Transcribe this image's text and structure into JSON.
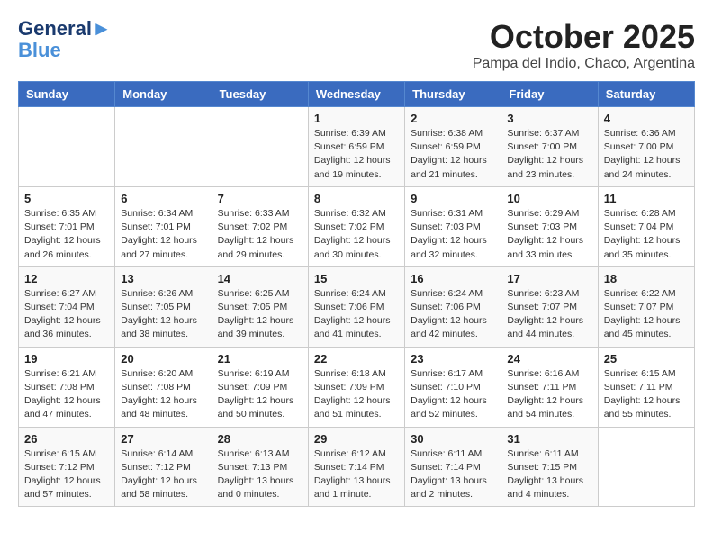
{
  "header": {
    "logo_line1": "General",
    "logo_line2": "Blue",
    "month": "October 2025",
    "location": "Pampa del Indio, Chaco, Argentina"
  },
  "days_of_week": [
    "Sunday",
    "Monday",
    "Tuesday",
    "Wednesday",
    "Thursday",
    "Friday",
    "Saturday"
  ],
  "weeks": [
    [
      {
        "day": "",
        "info": ""
      },
      {
        "day": "",
        "info": ""
      },
      {
        "day": "",
        "info": ""
      },
      {
        "day": "1",
        "info": "Sunrise: 6:39 AM\nSunset: 6:59 PM\nDaylight: 12 hours\nand 19 minutes."
      },
      {
        "day": "2",
        "info": "Sunrise: 6:38 AM\nSunset: 6:59 PM\nDaylight: 12 hours\nand 21 minutes."
      },
      {
        "day": "3",
        "info": "Sunrise: 6:37 AM\nSunset: 7:00 PM\nDaylight: 12 hours\nand 23 minutes."
      },
      {
        "day": "4",
        "info": "Sunrise: 6:36 AM\nSunset: 7:00 PM\nDaylight: 12 hours\nand 24 minutes."
      }
    ],
    [
      {
        "day": "5",
        "info": "Sunrise: 6:35 AM\nSunset: 7:01 PM\nDaylight: 12 hours\nand 26 minutes."
      },
      {
        "day": "6",
        "info": "Sunrise: 6:34 AM\nSunset: 7:01 PM\nDaylight: 12 hours\nand 27 minutes."
      },
      {
        "day": "7",
        "info": "Sunrise: 6:33 AM\nSunset: 7:02 PM\nDaylight: 12 hours\nand 29 minutes."
      },
      {
        "day": "8",
        "info": "Sunrise: 6:32 AM\nSunset: 7:02 PM\nDaylight: 12 hours\nand 30 minutes."
      },
      {
        "day": "9",
        "info": "Sunrise: 6:31 AM\nSunset: 7:03 PM\nDaylight: 12 hours\nand 32 minutes."
      },
      {
        "day": "10",
        "info": "Sunrise: 6:29 AM\nSunset: 7:03 PM\nDaylight: 12 hours\nand 33 minutes."
      },
      {
        "day": "11",
        "info": "Sunrise: 6:28 AM\nSunset: 7:04 PM\nDaylight: 12 hours\nand 35 minutes."
      }
    ],
    [
      {
        "day": "12",
        "info": "Sunrise: 6:27 AM\nSunset: 7:04 PM\nDaylight: 12 hours\nand 36 minutes."
      },
      {
        "day": "13",
        "info": "Sunrise: 6:26 AM\nSunset: 7:05 PM\nDaylight: 12 hours\nand 38 minutes."
      },
      {
        "day": "14",
        "info": "Sunrise: 6:25 AM\nSunset: 7:05 PM\nDaylight: 12 hours\nand 39 minutes."
      },
      {
        "day": "15",
        "info": "Sunrise: 6:24 AM\nSunset: 7:06 PM\nDaylight: 12 hours\nand 41 minutes."
      },
      {
        "day": "16",
        "info": "Sunrise: 6:24 AM\nSunset: 7:06 PM\nDaylight: 12 hours\nand 42 minutes."
      },
      {
        "day": "17",
        "info": "Sunrise: 6:23 AM\nSunset: 7:07 PM\nDaylight: 12 hours\nand 44 minutes."
      },
      {
        "day": "18",
        "info": "Sunrise: 6:22 AM\nSunset: 7:07 PM\nDaylight: 12 hours\nand 45 minutes."
      }
    ],
    [
      {
        "day": "19",
        "info": "Sunrise: 6:21 AM\nSunset: 7:08 PM\nDaylight: 12 hours\nand 47 minutes."
      },
      {
        "day": "20",
        "info": "Sunrise: 6:20 AM\nSunset: 7:08 PM\nDaylight: 12 hours\nand 48 minutes."
      },
      {
        "day": "21",
        "info": "Sunrise: 6:19 AM\nSunset: 7:09 PM\nDaylight: 12 hours\nand 50 minutes."
      },
      {
        "day": "22",
        "info": "Sunrise: 6:18 AM\nSunset: 7:09 PM\nDaylight: 12 hours\nand 51 minutes."
      },
      {
        "day": "23",
        "info": "Sunrise: 6:17 AM\nSunset: 7:10 PM\nDaylight: 12 hours\nand 52 minutes."
      },
      {
        "day": "24",
        "info": "Sunrise: 6:16 AM\nSunset: 7:11 PM\nDaylight: 12 hours\nand 54 minutes."
      },
      {
        "day": "25",
        "info": "Sunrise: 6:15 AM\nSunset: 7:11 PM\nDaylight: 12 hours\nand 55 minutes."
      }
    ],
    [
      {
        "day": "26",
        "info": "Sunrise: 6:15 AM\nSunset: 7:12 PM\nDaylight: 12 hours\nand 57 minutes."
      },
      {
        "day": "27",
        "info": "Sunrise: 6:14 AM\nSunset: 7:12 PM\nDaylight: 12 hours\nand 58 minutes."
      },
      {
        "day": "28",
        "info": "Sunrise: 6:13 AM\nSunset: 7:13 PM\nDaylight: 13 hours\nand 0 minutes."
      },
      {
        "day": "29",
        "info": "Sunrise: 6:12 AM\nSunset: 7:14 PM\nDaylight: 13 hours\nand 1 minute."
      },
      {
        "day": "30",
        "info": "Sunrise: 6:11 AM\nSunset: 7:14 PM\nDaylight: 13 hours\nand 2 minutes."
      },
      {
        "day": "31",
        "info": "Sunrise: 6:11 AM\nSunset: 7:15 PM\nDaylight: 13 hours\nand 4 minutes."
      },
      {
        "day": "",
        "info": ""
      }
    ]
  ]
}
